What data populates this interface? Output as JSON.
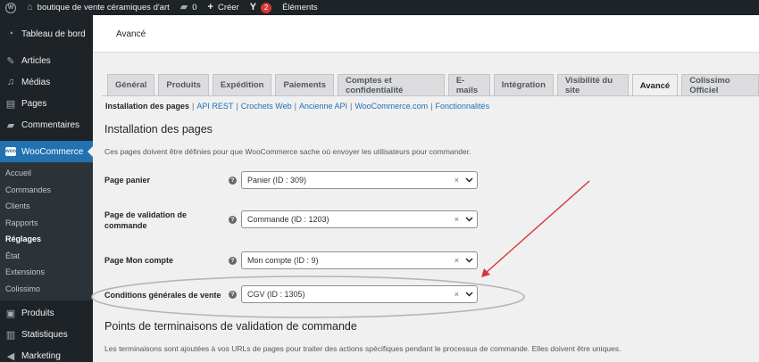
{
  "adminbar": {
    "site_name": "boutique de vente céramiques d'art",
    "comments_count": "0",
    "new_label": "Créer",
    "yoast_badge": "2",
    "elements_label": "Éléments"
  },
  "sidebar": {
    "items_top": [
      {
        "label": "Tableau de bord",
        "icon": "dashboard-icon"
      },
      {
        "label": "Articles",
        "icon": "pin-icon"
      },
      {
        "label": "Médias",
        "icon": "media-icon"
      },
      {
        "label": "Pages",
        "icon": "page-icon"
      },
      {
        "label": "Commentaires",
        "icon": "comment-icon"
      }
    ],
    "woocommerce_label": "WooCommerce",
    "woo_icon_text": "woo",
    "submenu": [
      "Accueil",
      "Commandes",
      "Clients",
      "Rapports",
      "Réglages",
      "État",
      "Extensions",
      "Colissimo"
    ],
    "current_submenu": "Réglages",
    "items_bottom": [
      {
        "label": "Produits",
        "icon": "products-icon"
      },
      {
        "label": "Statistiques",
        "icon": "stats-icon"
      },
      {
        "label": "Marketing",
        "icon": "megaphone-icon"
      }
    ]
  },
  "header": {
    "title": "Avancé"
  },
  "tabs": [
    {
      "label": "Général",
      "active": false
    },
    {
      "label": "Produits",
      "active": false
    },
    {
      "label": "Expédition",
      "active": false
    },
    {
      "label": "Paiements",
      "active": false
    },
    {
      "label": "Comptes et confidentialité",
      "active": false
    },
    {
      "label": "E-mails",
      "active": false
    },
    {
      "label": "Intégration",
      "active": false
    },
    {
      "label": "Visibilité du site",
      "active": false
    },
    {
      "label": "Avancé",
      "active": true
    },
    {
      "label": "Colissimo Officiel",
      "active": false
    }
  ],
  "subsections": {
    "current": "Installation des pages",
    "links": [
      "API REST",
      "Crochets Web",
      "Ancienne API",
      "WooCommerce.com",
      "Fonctionnalités"
    ],
    "separator": "|"
  },
  "section_pages": {
    "title": "Installation des pages",
    "description": "Ces pages doivent être définies pour que WooCommerce sache où envoyer les utilisateurs pour commander."
  },
  "fields": [
    {
      "label": "Page panier",
      "value": "Panier (ID : 309)"
    },
    {
      "label": "Page de validation de commande",
      "value": "Commande (ID : 1203)"
    },
    {
      "label": "Page Mon compte",
      "value": "Mon compte (ID : 9)"
    },
    {
      "label": "Conditions générales de vente",
      "value": "CGV (ID : 1305)"
    }
  ],
  "help_symbol": "?",
  "clear_symbol": "×",
  "section_endpoints": {
    "title": "Points de terminaisons de validation de commande",
    "description": "Les terminaisons sont ajoutées à vos URLs de pages pour traiter des actions spécifiques pendant le processus de commande. Elles doivent être uniques."
  },
  "colors": {
    "admin_dark": "#1d2327",
    "accent_blue": "#2271b1",
    "annotation_red": "#d63638",
    "annotation_ellipse": "#b5b5b5"
  }
}
